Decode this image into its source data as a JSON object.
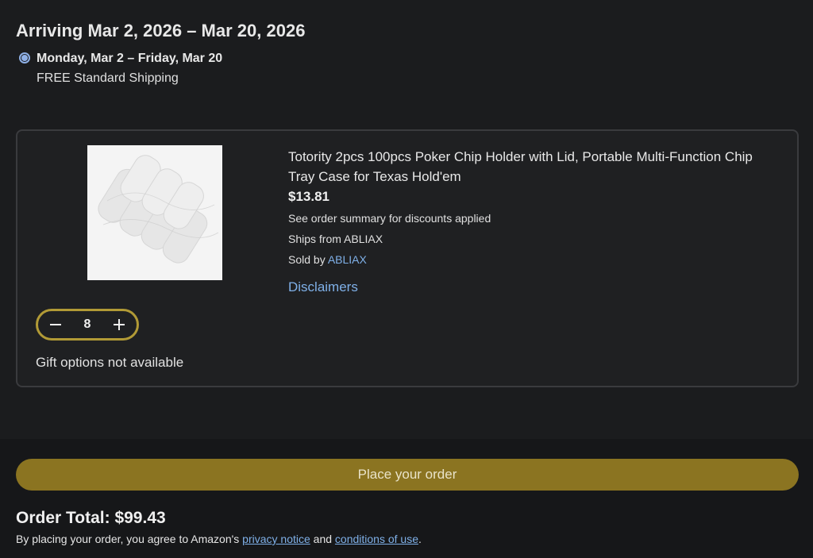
{
  "delivery": {
    "heading": "Arriving Mar 2, 2026 – Mar 20, 2026",
    "option_dates": "Monday, Mar 2 – Friday, Mar 20",
    "option_method": "FREE Standard Shipping"
  },
  "item": {
    "title": "Totority 2pcs 100pcs Poker Chip Holder with Lid, Portable Multi-Function Chip Tray Case for Texas Hold'em",
    "price": "$13.81",
    "discount_note": "See order summary for discounts applied",
    "ships_from": "Ships from ABLIAX",
    "sold_by_prefix": "Sold by ",
    "seller": "ABLIAX",
    "disclaimers": "Disclaimers",
    "quantity": "8",
    "gift_note": "Gift options not available"
  },
  "footer": {
    "place_order": "Place your order",
    "order_total": "Order Total: $99.43",
    "agree_prefix": "By placing your order, you agree to Amazon's ",
    "privacy_link": "privacy notice",
    "agree_and": " and ",
    "conditions_link": "conditions of use",
    "agree_suffix": "."
  },
  "colors": {
    "accent_button": "#8b7421",
    "link": "#7fb0e8",
    "quantity_border": "#b19a36"
  },
  "icons": {
    "minus": "minus-icon",
    "plus": "plus-icon",
    "radio": "radio-selected-icon"
  }
}
